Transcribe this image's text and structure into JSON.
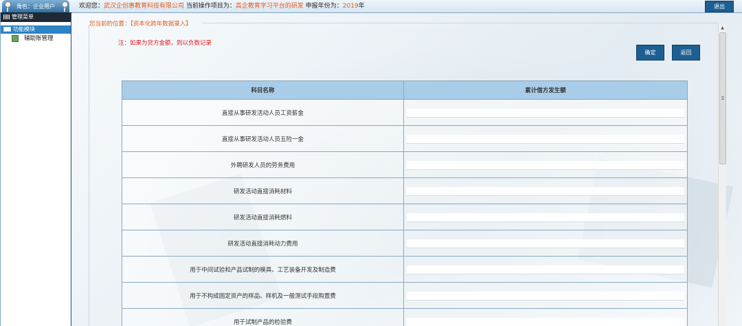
{
  "header": {
    "role_label": "角色：企业用户",
    "welcome_prefix": "欢迎您：",
    "company": "武汉企创惠教育科技有限公司",
    "project_prefix": " 当前操作项目为：",
    "project": "高企教育学习平台的研发",
    "year_prefix": " 申报年份为：",
    "year": "2019",
    "year_suffix": "年",
    "exit_label": "退出"
  },
  "sidebar": {
    "menu_title": "管理菜单",
    "module_title": "功能模块",
    "items": [
      {
        "label": "辅助账管理"
      }
    ]
  },
  "main": {
    "breadcrumb": "您当前的位置：【资本化跨年数据录入】",
    "notice": "注：如果为贷方金额，则以负数记录",
    "confirm_label": "确定",
    "back_label": "返回",
    "table": {
      "headers": [
        "科目名称",
        "累计借方发生额"
      ],
      "rows": [
        {
          "name": "直接从事研发活动人员工资薪金",
          "value": ""
        },
        {
          "name": "直接从事研发活动人员五险一金",
          "value": ""
        },
        {
          "name": "外聘研发人员的劳务费用",
          "value": ""
        },
        {
          "name": "研发活动直接消耗材料",
          "value": ""
        },
        {
          "name": "研发活动直接消耗燃料",
          "value": ""
        },
        {
          "name": "研发活动直接消耗动力费用",
          "value": ""
        },
        {
          "name": "用于中间试验和产品试制的模具、工艺装备开发及制造费",
          "value": ""
        },
        {
          "name": "用于不构成固定资产的样品、样机及一般测试手段购置费",
          "value": ""
        },
        {
          "name": "用于试制产品的检验费",
          "value": ""
        }
      ]
    }
  },
  "colors": {
    "accent": "#1d5f92",
    "header_highlight": "#e55a1c",
    "notice": "#e02323",
    "table_header": "#a9cde8"
  }
}
